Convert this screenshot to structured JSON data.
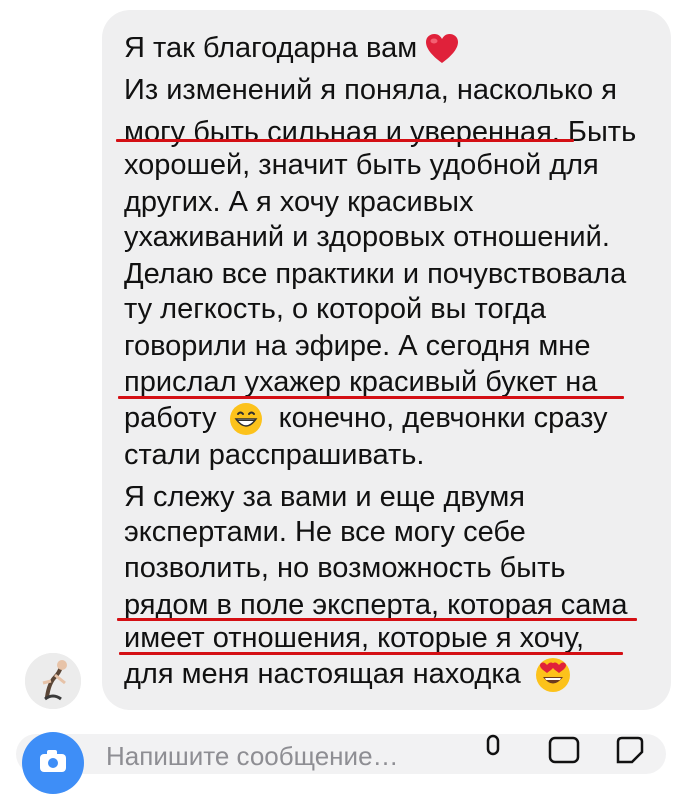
{
  "message": {
    "lines": [
      "Я так благодарна вам",
      "Из изменений я поняла, насколько я",
      "могу быть сильная и уверенная. Быть",
      "хорошей, значит быть удобной для",
      "других. А я хочу красивых",
      "ухаживаний и здоровых отношений.",
      "Делаю все практики и почувствовала",
      "ту легкость, о которой вы тогда",
      "говорили на эфире. А сегодня мне",
      "прислал ухажер красивый букет на",
      "работу",
      "конечно, девчонки сразу",
      "стали расспрашивать.",
      "Я слежу за вами и еще двумя",
      "экспертами. Не все могу себе",
      "позволить, но возможность быть",
      "рядом в поле эксперта, которая сама",
      "имеет отношения, которые я хочу,",
      "для меня настоящая находка"
    ]
  },
  "colors": {
    "bubble": "#efeff0",
    "underline": "#d40f14",
    "camera": "#3e8ef7"
  },
  "icons": {
    "heart": "heart-emoji-icon",
    "grin": "grinning-emoji-icon",
    "hearteyes": "heart-eyes-emoji-icon",
    "camera": "camera-icon",
    "mic": "microphone-icon",
    "gallery": "gallery-icon",
    "sticker": "sticker-icon"
  },
  "composer": {
    "placeholder": "Напишите сообщение…"
  }
}
